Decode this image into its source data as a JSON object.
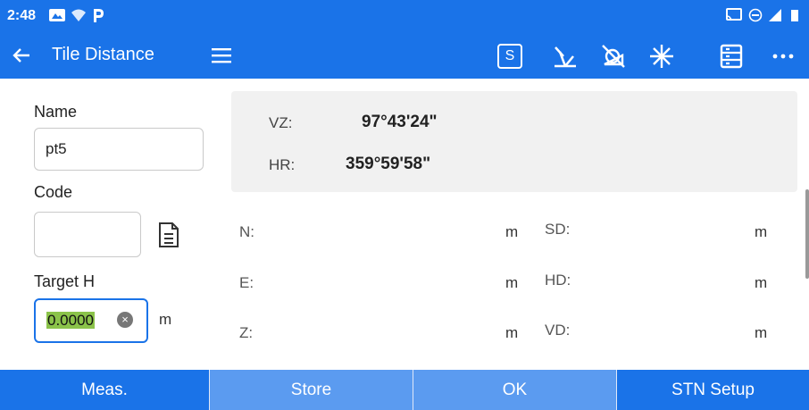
{
  "status_bar": {
    "time": "2:48",
    "icons": [
      "gallery-notification-icon",
      "wifi-icon",
      "p-app-icon",
      "cast-icon",
      "dnd-icon",
      "signal-icon",
      "battery-icon"
    ]
  },
  "app_bar": {
    "title": "Tile Distance",
    "s_label": "S",
    "icons": [
      "back-arrow-icon",
      "menu-icon",
      "s-mode-icon",
      "prism-off-icon",
      "target-icon",
      "laser-icon",
      "list-icon",
      "more-icon"
    ]
  },
  "form": {
    "name_label": "Name",
    "name_value": "pt5",
    "code_label": "Code",
    "code_value": "",
    "target_h_label": "Target H",
    "target_h_value": "0.0000",
    "target_h_unit": "m"
  },
  "angles": {
    "vz_label": "VZ:",
    "vz_value": "97°43'24\"",
    "hr_label": "HR:",
    "hr_value": "359°59'58\""
  },
  "results": {
    "n_label": "N:",
    "n_unit": "m",
    "e_label": "E:",
    "e_unit": "m",
    "z_label": "Z:",
    "z_unit": "m",
    "sd_label": "SD:",
    "sd_unit": "m",
    "hd_label": "HD:",
    "hd_unit": "m",
    "vd_label": "VD:",
    "vd_unit": "m"
  },
  "bottom_buttons": {
    "meas": "Meas.",
    "store": "Store",
    "ok": "OK",
    "stn_setup": "STN Setup"
  },
  "colors": {
    "primary": "#1a73e8",
    "secondary_button": "#5b9bf0",
    "selection": "#8bc34a",
    "panel": "#f1f1f1"
  }
}
